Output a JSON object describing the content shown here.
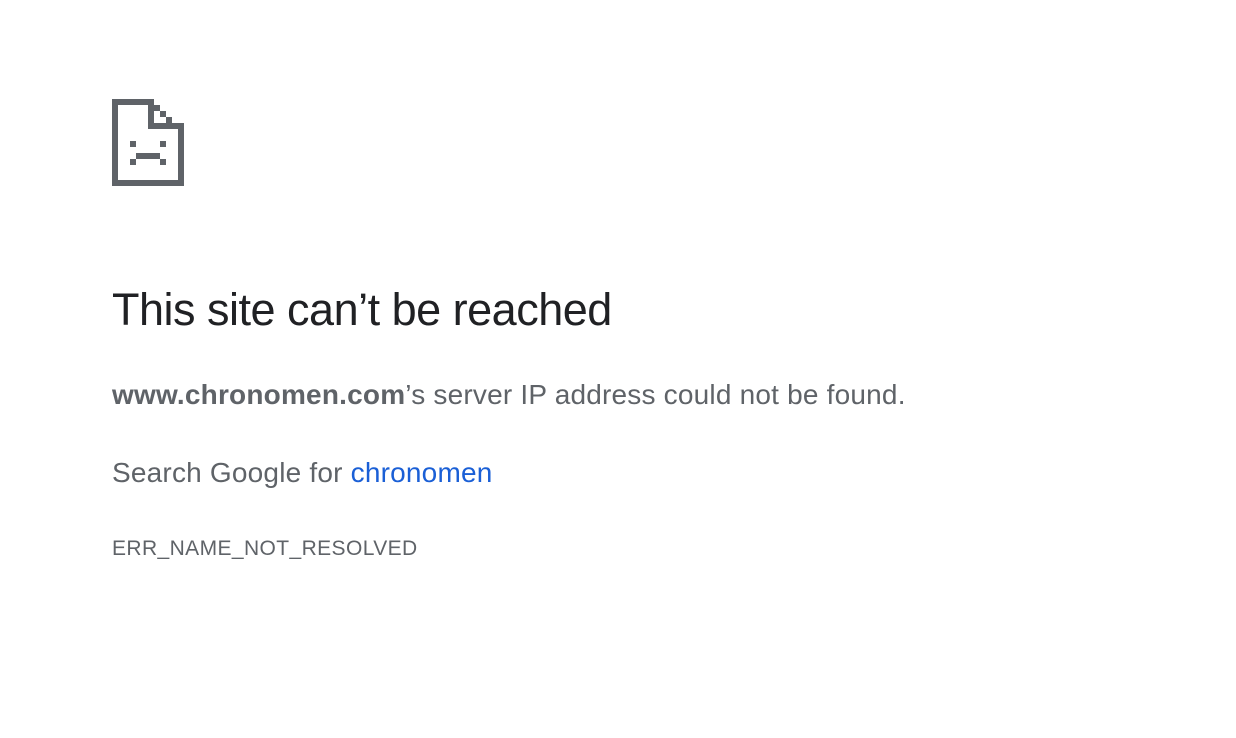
{
  "error_page": {
    "icon": "sad-page-icon",
    "heading": "This site can’t be reached",
    "summary": {
      "host": "www.chronomen.com",
      "suffix": "’s server IP address could not be found."
    },
    "suggestion": {
      "prefix": "Search Google for ",
      "link_text": "chronomen"
    },
    "error_code": "ERR_NAME_NOT_RESOLVED",
    "colors": {
      "heading": "#202124",
      "body": "#5f6368",
      "link": "#1a5fd6",
      "icon": "#5f6368"
    }
  }
}
